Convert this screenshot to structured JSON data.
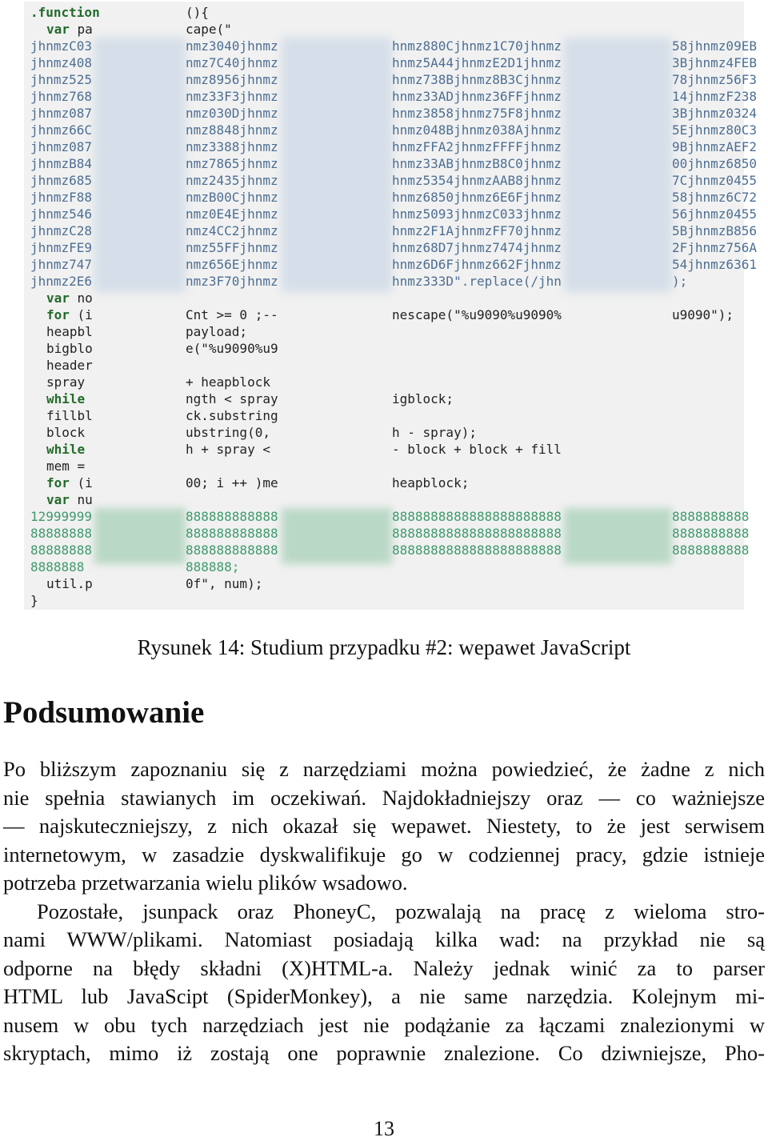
{
  "figure": {
    "code_top": [
      {
        "a": ".function",
        "b": "(){"
      },
      {
        "a": "var pa",
        "b": "cape(\""
      }
    ],
    "hex_lines": [
      [
        "jhnmzC03",
        "nmz3040jhnmz",
        "hnmz880Cjhnmz1C70jhnmz",
        "58jhnmz09EB"
      ],
      [
        "jhnmz408",
        "nmz7C40jhnmz",
        "hnmz5A44jhnmzE2D1jhnmz",
        "3Bjhnmz4FEB"
      ],
      [
        "jhnmz525",
        "nmz8956jhnmz",
        "hnmz738Bjhnmz8B3Cjhnmz",
        "78jhnmz56F3"
      ],
      [
        "jhnmz768",
        "nmz33F3jhnmz",
        "hnmz33ADjhnmz36FFjhnmz",
        "14jhnmzF238"
      ],
      [
        "jhnmz087",
        "nmz030Djhnmz",
        "hnmz3858jhnmz75F8jhnmz",
        "3Bjhnmz0324"
      ],
      [
        "jhnmz66C",
        "nmz8848jhnmz",
        "hnmz048Bjhnmz038Ajhnmz",
        "5Ejhnmz80C3"
      ],
      [
        "jhnmz087",
        "nmz3388jhnmz",
        "hnmzFFA2jhnmzFFFFjhnmz",
        "9BjhnmzAEF2"
      ],
      [
        "jhnmzB84",
        "nmz7865jhnmz",
        "hnmz33ABjhnmzB8C0jhnmz",
        "00jhnmz6850"
      ],
      [
        "jhnmz685",
        "nmz2435jhnmz",
        "hnmz5354jhnmzAAB8jhnmz",
        "7Cjhnmz0455"
      ],
      [
        "jhnmzF88",
        "nmzB00Cjhnmz",
        "hnmz6850jhnmz6E6Fjhnmz",
        "58jhnmz6C72"
      ],
      [
        "jhnmz546",
        "nmz0E4Ejhnmz",
        "hnmz5093jhnmzC033jhnmz",
        "56jhnmz0455"
      ],
      [
        "jhnmzC28",
        "nmz4CC2jhnmz",
        "hnmz2F1AjhnmzFF70jhnmz",
        "5BjhnmzB856"
      ],
      [
        "jhnmzFE9",
        "nmz55FFjhnmz",
        "hnmz68D7jhnmz7474jhnmz",
        "2Fjhnmz756A"
      ],
      [
        "jhnmz747",
        "nmz656Ejhnmz",
        "hnmz6D6Fjhnmz662Fjhnmz",
        "54jhnmz6361"
      ],
      [
        "jhnmz2E6",
        "nmz3F70jhnmz",
        "hnmz333D\".replace(/jhn",
        ");"
      ]
    ],
    "code_body": [
      {
        "a": "var no"
      },
      {
        "a": "for (i",
        "b": "Cnt >= 0 ;--",
        "c": "nescape(\"%u9090%u9090%",
        "d": "u9090\");"
      },
      {
        "a": "heapbl",
        "b": "payload;"
      },
      {
        "a": "bigblo",
        "b": "e(\"%u9090%u9"
      },
      {
        "a": "header"
      },
      {
        "a": "spray",
        "b": "+ heapblock"
      },
      {
        "a": "while",
        "b": "ngth < spray",
        "c": "igblock;"
      },
      {
        "a": "fillbl",
        "b": "ck.substring"
      },
      {
        "a": "block",
        "b": "ubstring(0,",
        "c": "h - spray);"
      },
      {
        "a": "while",
        "b": "h + spray <",
        "c": "- block + block + fill"
      },
      {
        "a": "mem ="
      },
      {
        "a": "for (i",
        "b": "00; i ++ )me",
        "c": "heapblock;"
      },
      {
        "a": "var nu"
      }
    ],
    "num_lines": [
      [
        "12999999",
        "888888888888",
        "8888888888888888888888",
        "8888888888"
      ],
      [
        "88888888",
        "888888888888",
        "8888888888888888888888",
        "8888888888"
      ],
      [
        "88888888",
        "888888888888",
        "8888888888888888888888",
        "8888888888"
      ],
      [
        "8888888",
        "888888;"
      ]
    ],
    "code_end": [
      {
        "a": "util.p",
        "b": "0f\", num);"
      },
      {
        "a": "}"
      }
    ]
  },
  "caption": "Rysunek 14: Studium przypadku #2: wepawet JavaScript",
  "section_title": "Podsumowanie",
  "paragraph_lines": [
    "Po bliższym zapoznaniu się z narzędziami można powiedzieć, że żadne z nich",
    "nie spełnia stawianych im oczekiwań. Najdokładniejszy oraz — co ważniejsze",
    "— najskuteczniejszy, z nich okazał się wepawet. Niestety, to że jest serwisem",
    "internetowym, w zasadzie dyskwalifikuje go w codziennej pracy, gdzie istnieje",
    "potrzeba przetwarzania wielu plików wsadowo.",
    "Pozostałe, jsunpack oraz PhoneyC, pozwalają na pracę z wieloma stro-",
    "nami WWW/plikami. Natomiast posiadają kilka wad: na przykład nie są",
    "odporne na błędy składni (X)HTML-a. Należy jednak winić za to parser",
    "HTML lub JavaScipt (SpiderMonkey), a nie same narzędzia. Kolejnym mi-",
    "nusem w obu tych narzędziach jest nie podążanie za łączami znalezionymi w",
    "skryptach, mimo iż zostają one poprawnie znalezione. Co dziwniejsze, Pho-"
  ],
  "page_number": "13"
}
